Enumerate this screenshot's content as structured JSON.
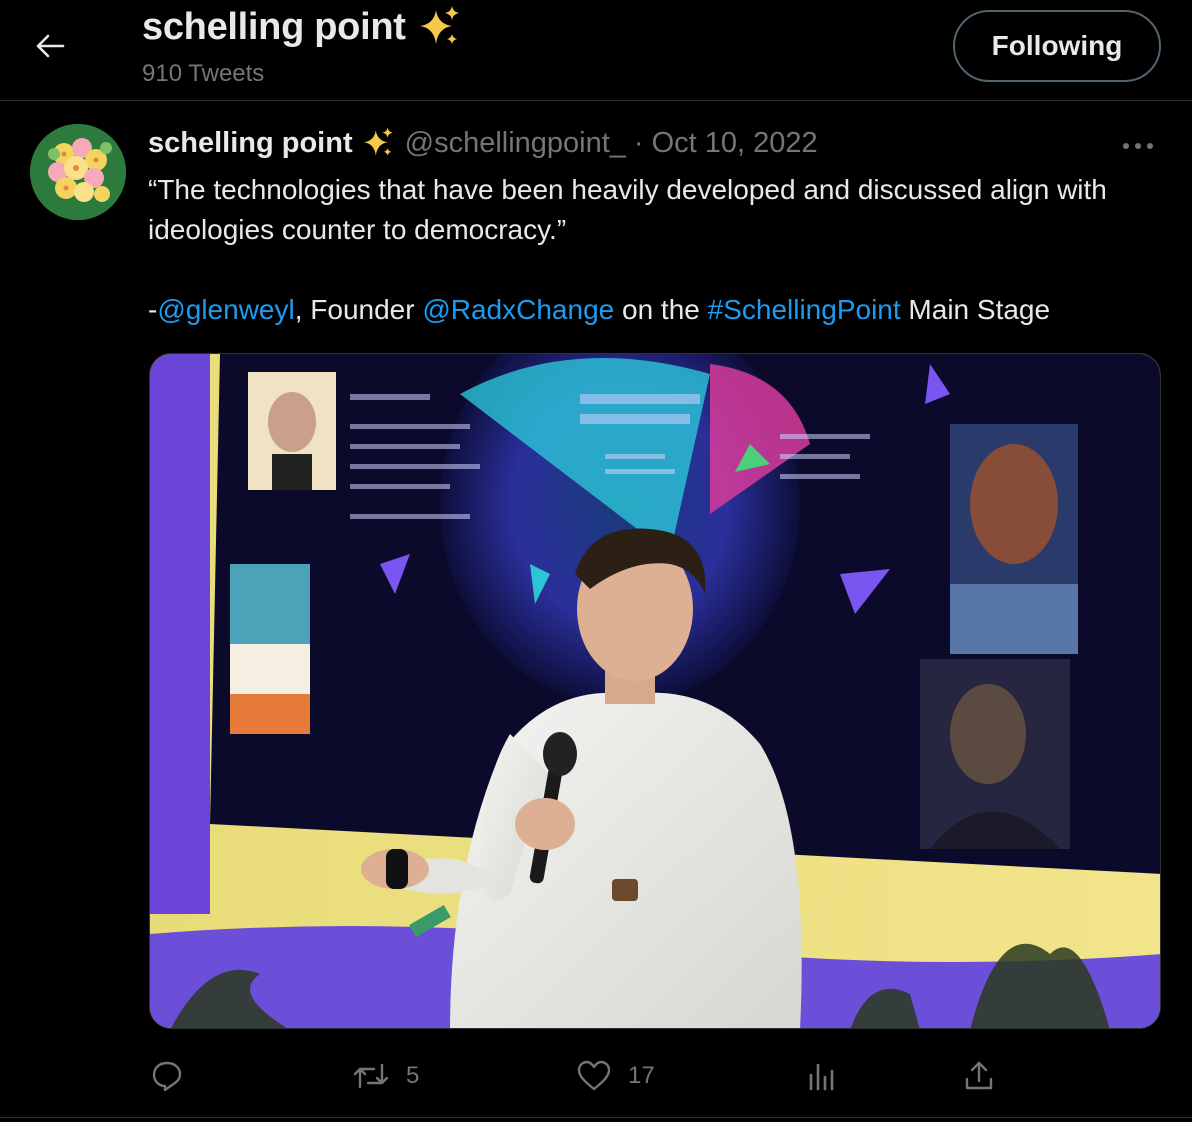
{
  "header": {
    "back_icon": "arrow-left-icon",
    "title": "schelling point",
    "title_emoji": "sparkles-icon",
    "tweet_count": "910 Tweets",
    "follow_label": "Following"
  },
  "tweet": {
    "avatar": "flower-avatar",
    "author_name": "schelling point",
    "author_emoji": "sparkles-icon",
    "handle": "@schellingpoint_",
    "separator": "·",
    "date": "Oct 10, 2022",
    "more_icon": "more-horizontal-icon",
    "text_line1": "“The technologies that have been heavily developed and discussed align with ideologies counter to democracy.”",
    "attribution": {
      "prefix": "-",
      "mention1": "@glenweyl",
      "middle1": ", Founder ",
      "mention2": "@RadxChange",
      "middle2": " on the ",
      "hashtag": "#SchellingPoint",
      "suffix": " Main Stage"
    },
    "media_description_icon": "photo-speaker-on-stage"
  },
  "actions": {
    "reply": {
      "icon": "reply-icon",
      "count": ""
    },
    "retweet": {
      "icon": "retweet-icon",
      "count": "5"
    },
    "like": {
      "icon": "heart-icon",
      "count": "17"
    },
    "views": {
      "icon": "analytics-icon",
      "count": ""
    },
    "share": {
      "icon": "share-icon",
      "count": ""
    }
  },
  "colors": {
    "background": "#000000",
    "text": "#e7e9ea",
    "secondary": "#71767b",
    "link": "#1d9bf0",
    "border": "#2f3336"
  }
}
